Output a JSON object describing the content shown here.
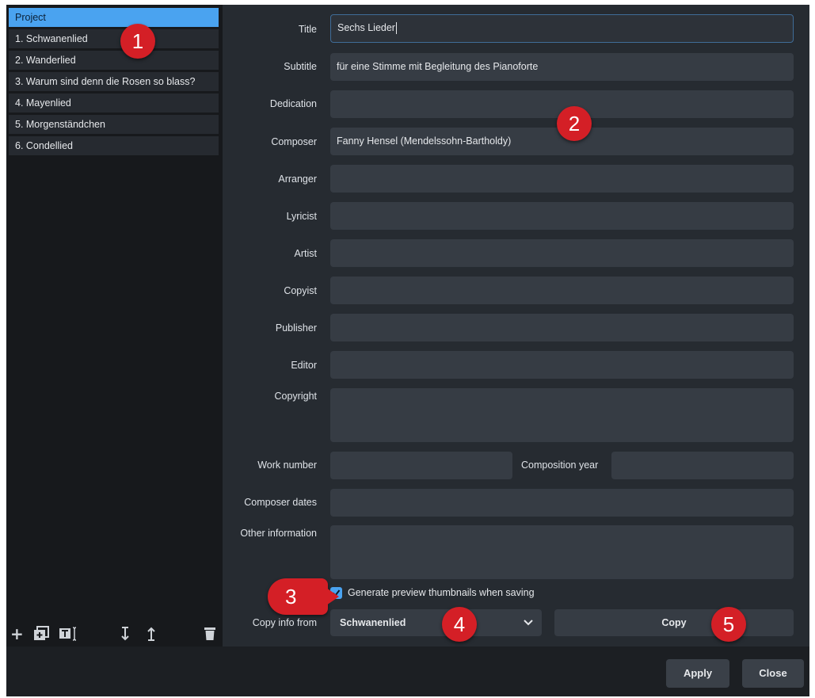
{
  "sidebar": {
    "items": [
      {
        "label": "Project",
        "active": true
      },
      {
        "label": "1. Schwanenlied"
      },
      {
        "label": "2. Wanderlied"
      },
      {
        "label": "3. Warum sind denn die Rosen so blass?"
      },
      {
        "label": "4. Mayenlied"
      },
      {
        "label": "5. Morgenständchen"
      },
      {
        "label": "6. Condellied"
      }
    ],
    "toolbar_icons": [
      "add-icon",
      "duplicate-icon",
      "rename-icon",
      "move-down-icon",
      "move-up-icon",
      "delete-icon"
    ]
  },
  "form": {
    "title": {
      "label": "Title",
      "value": "Sechs Lieder"
    },
    "subtitle": {
      "label": "Subtitle",
      "value": "für eine Stimme mit Begleitung des Pianoforte"
    },
    "dedication": {
      "label": "Dedication",
      "value": ""
    },
    "composer": {
      "label": "Composer",
      "value": "Fanny Hensel (Mendelssohn-Bartholdy)"
    },
    "arranger": {
      "label": "Arranger",
      "value": ""
    },
    "lyricist": {
      "label": "Lyricist",
      "value": ""
    },
    "artist": {
      "label": "Artist",
      "value": ""
    },
    "copyist": {
      "label": "Copyist",
      "value": ""
    },
    "publisher": {
      "label": "Publisher",
      "value": ""
    },
    "editor": {
      "label": "Editor",
      "value": ""
    },
    "copyright": {
      "label": "Copyright",
      "value": ""
    },
    "work_number": {
      "label": "Work number",
      "value": ""
    },
    "composition_year": {
      "label": "Composition year",
      "value": ""
    },
    "composer_dates": {
      "label": "Composer dates",
      "value": ""
    },
    "other_information": {
      "label": "Other information",
      "value": ""
    },
    "thumbnails": {
      "label": "Generate preview thumbnails when saving",
      "checked": true
    },
    "copy_from": {
      "label": "Copy info from",
      "selected": "Schwanenlied"
    },
    "copy_button": "Copy"
  },
  "footer": {
    "apply": "Apply",
    "close": "Close"
  },
  "callouts": [
    "1",
    "2",
    "3",
    "4",
    "5"
  ],
  "colors": {
    "accent": "#4aa3f0",
    "callout": "#d41f26",
    "background": "#262b31",
    "sidebar": "#17191c"
  }
}
